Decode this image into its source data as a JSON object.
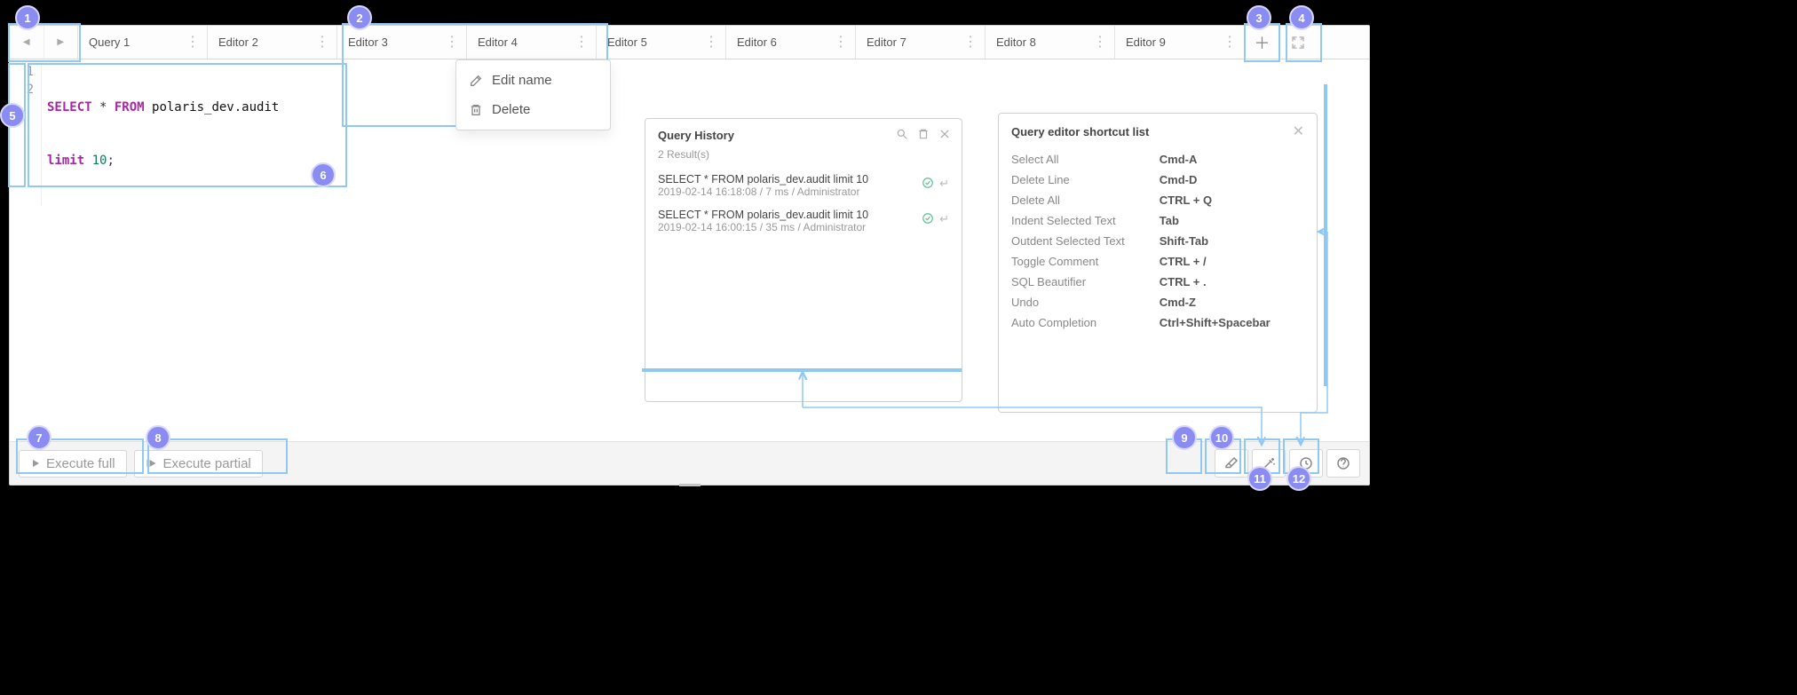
{
  "tabs": [
    {
      "label": "Query 1"
    },
    {
      "label": "Editor 2"
    },
    {
      "label": "Editor 3"
    },
    {
      "label": "Editor 4"
    },
    {
      "label": "Editor 5"
    },
    {
      "label": "Editor 6"
    },
    {
      "label": "Editor 7"
    },
    {
      "label": "Editor 8"
    },
    {
      "label": "Editor 9"
    }
  ],
  "code": {
    "line1": {
      "num": "1",
      "kw1": "SELECT",
      "star": " * ",
      "kw2": "FROM",
      "id": " polaris_dev.audit"
    },
    "line2": {
      "num": "2",
      "kw": "limit ",
      "val": "10",
      "semi": ";"
    }
  },
  "ctx": {
    "edit": "Edit name",
    "delete": "Delete"
  },
  "history": {
    "title": "Query History",
    "result_count": "2 Result(s)",
    "items": [
      {
        "query": "SELECT * FROM polaris_dev.audit limit 10",
        "meta": "2019-02-14 16:18:08 / 7 ms / Administrator"
      },
      {
        "query": "SELECT * FROM polaris_dev.audit limit 10",
        "meta": "2019-02-14 16:00:15 / 35 ms / Administrator"
      }
    ]
  },
  "shortcuts": {
    "title": "Query editor shortcut list",
    "rows": [
      {
        "label": "Select All",
        "key": "Cmd-A"
      },
      {
        "label": "Delete Line",
        "key": "Cmd-D"
      },
      {
        "label": "Delete All",
        "key": "CTRL + Q"
      },
      {
        "label": "Indent Selected Text",
        "key": "Tab"
      },
      {
        "label": "Outdent Selected Text",
        "key": "Shift-Tab"
      },
      {
        "label": "Toggle Comment",
        "key": "CTRL + /"
      },
      {
        "label": "SQL Beautifier",
        "key": "CTRL + ."
      },
      {
        "label": "Undo",
        "key": "Cmd-Z"
      },
      {
        "label": "Auto Completion",
        "key": "Ctrl+Shift+Spacebar"
      }
    ]
  },
  "bottom": {
    "execute_full": "Execute full",
    "execute_partial": "Execute partial"
  },
  "annotations": {
    "1": "1",
    "2": "2",
    "3": "3",
    "4": "4",
    "5": "5",
    "6": "6",
    "7": "7",
    "8": "8",
    "9": "9",
    "10": "10",
    "11": "11",
    "12": "12"
  }
}
